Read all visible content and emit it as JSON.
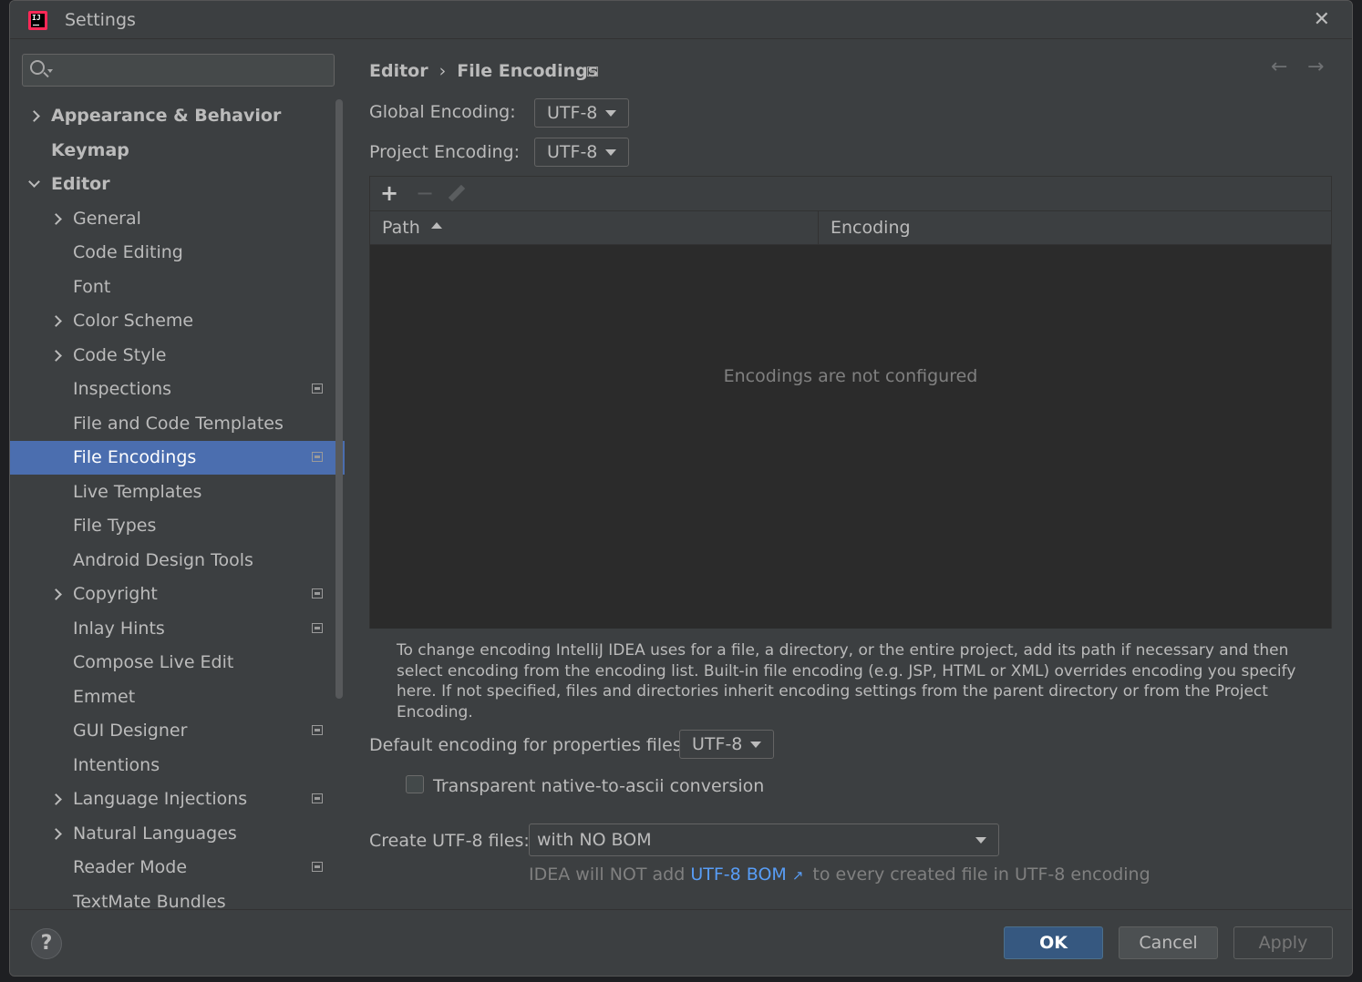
{
  "window": {
    "title": "Settings",
    "app_icon_text": "IJ"
  },
  "search": {
    "placeholder": ""
  },
  "sidebar": {
    "items": [
      {
        "label": "Appearance & Behavior",
        "expander": "collapsed",
        "bold": true
      },
      {
        "label": "Keymap",
        "expander": "none",
        "bold": true
      },
      {
        "label": "Editor",
        "expander": "expanded",
        "bold": true
      },
      {
        "label": "General",
        "expander": "collapsed"
      },
      {
        "label": "Code Editing",
        "expander": "none"
      },
      {
        "label": "Font",
        "expander": "none"
      },
      {
        "label": "Color Scheme",
        "expander": "collapsed"
      },
      {
        "label": "Code Style",
        "expander": "collapsed"
      },
      {
        "label": "Inspections",
        "expander": "none",
        "project_icon": true
      },
      {
        "label": "File and Code Templates",
        "expander": "none"
      },
      {
        "label": "File Encodings",
        "expander": "none",
        "project_icon": true,
        "selected": true
      },
      {
        "label": "Live Templates",
        "expander": "none"
      },
      {
        "label": "File Types",
        "expander": "none"
      },
      {
        "label": "Android Design Tools",
        "expander": "none"
      },
      {
        "label": "Copyright",
        "expander": "collapsed",
        "project_icon": true
      },
      {
        "label": "Inlay Hints",
        "expander": "none",
        "project_icon": true
      },
      {
        "label": "Compose Live Edit",
        "expander": "none"
      },
      {
        "label": "Emmet",
        "expander": "none"
      },
      {
        "label": "GUI Designer",
        "expander": "none",
        "project_icon": true
      },
      {
        "label": "Intentions",
        "expander": "none"
      },
      {
        "label": "Language Injections",
        "expander": "collapsed",
        "project_icon": true
      },
      {
        "label": "Natural Languages",
        "expander": "collapsed"
      },
      {
        "label": "Reader Mode",
        "expander": "none",
        "project_icon": true
      },
      {
        "label": "TextMate Bundles",
        "expander": "none"
      }
    ]
  },
  "breadcrumb": {
    "parent": "Editor",
    "separator": "›",
    "current": "File Encodings"
  },
  "nav": {
    "back": "←",
    "forward": "→"
  },
  "global_encoding": {
    "label": "Global Encoding:",
    "value": "UTF-8"
  },
  "project_encoding": {
    "label": "Project Encoding:",
    "value": "UTF-8"
  },
  "table": {
    "toolbar": {
      "add": "+",
      "remove": "−"
    },
    "columns": [
      "Path",
      "Encoding"
    ],
    "sort_column": "Path",
    "empty_text": "Encodings are not configured"
  },
  "note": "To change encoding IntelliJ IDEA uses for a file, a directory, or the entire project, add its path if necessary and then select encoding from the encoding list. Built-in file encoding (e.g. JSP, HTML or XML) overrides encoding you specify here. If not specified, files and directories inherit encoding settings from the parent directory or from the Project Encoding.",
  "properties_encoding": {
    "label": "Default encoding for properties files:",
    "value": "UTF-8"
  },
  "native_to_ascii": {
    "label": "Transparent native-to-ascii conversion",
    "checked": false
  },
  "create_utf8": {
    "label": "Create UTF-8 files:",
    "value": "with NO BOM"
  },
  "hint": {
    "prefix": "IDEA will NOT add",
    "link": "UTF-8 BOM",
    "link_icon": "↗",
    "suffix": "to every created file in UTF-8 encoding"
  },
  "footer": {
    "help": "?",
    "ok": "OK",
    "cancel": "Cancel",
    "apply": "Apply"
  },
  "colors": {
    "selection": "#4b6eaf",
    "ok_button": "#365880",
    "link": "#589df6",
    "background": "#3c3f41"
  }
}
